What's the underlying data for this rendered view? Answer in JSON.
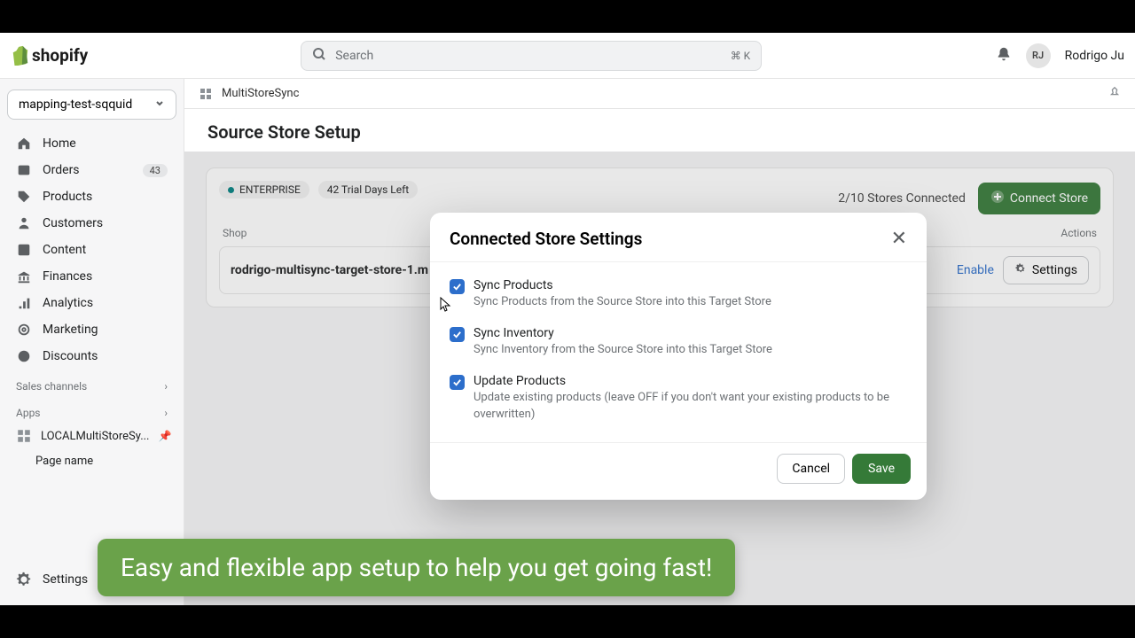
{
  "brand": "shopify",
  "search": {
    "placeholder": "Search",
    "shortcut": "⌘ K"
  },
  "user": {
    "initials": "RJ",
    "name": "Rodrigo Ju"
  },
  "store_selector": "mapping-test-sqquid",
  "nav": {
    "home": "Home",
    "orders": "Orders",
    "orders_badge": "43",
    "products": "Products",
    "customers": "Customers",
    "content": "Content",
    "finances": "Finances",
    "analytics": "Analytics",
    "marketing": "Marketing",
    "discounts": "Discounts"
  },
  "sections": {
    "sales_channels": "Sales channels",
    "apps": "Apps"
  },
  "apps_list": {
    "item0": "LOCALMultiStoreSy...",
    "item1": "Page name"
  },
  "settings_label": "Settings",
  "breadcrumb": {
    "app": "MultiStoreSync"
  },
  "page_title": "Source Store Setup",
  "chips": {
    "plan": "ENTERPRISE",
    "trial": "42 Trial Days Left"
  },
  "stores_connected": "2/10 Stores Connected",
  "connect_store": "Connect Store",
  "table": {
    "head_shop": "Shop",
    "head_actions": "Actions",
    "row0_shop": "rodrigo-multisync-target-store-1.m",
    "enable": "Enable",
    "settings": "Settings"
  },
  "modal": {
    "title": "Connected Store Settings",
    "opt1_label": "Sync Products",
    "opt1_desc": "Sync Products from the Source Store into this Target Store",
    "opt2_label": "Sync Inventory",
    "opt2_desc": "Sync Inventory from the Source Store into this Target Store",
    "opt3_label": "Update Products",
    "opt3_desc": "Update existing products (leave OFF if you don't want your existing products to be overwritten)",
    "cancel": "Cancel",
    "save": "Save"
  },
  "caption": "Easy and flexible app setup to help you get going fast!"
}
